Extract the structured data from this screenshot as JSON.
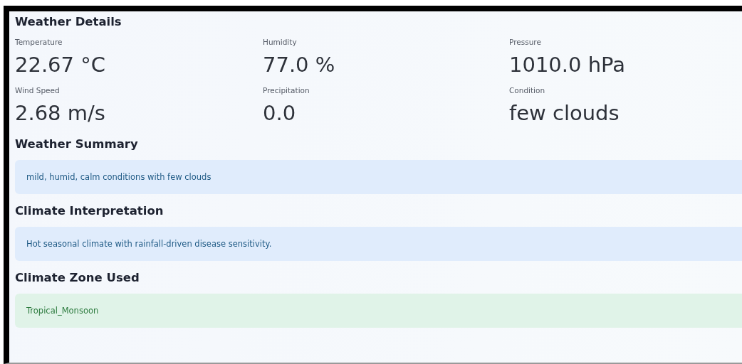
{
  "title": "Weather Details",
  "metrics": [
    {
      "label": "Temperature",
      "value": "22.67 °C"
    },
    {
      "label": "Humidity",
      "value": "77.0 %"
    },
    {
      "label": "Pressure",
      "value": "1010.0 hPa"
    },
    {
      "label": "Wind Speed",
      "value": "2.68 m/s"
    },
    {
      "label": "Precipitation",
      "value": "0.0"
    },
    {
      "label": "Condition",
      "value": "few clouds"
    }
  ],
  "sections": [
    {
      "heading": "Weather Summary",
      "kind": "info",
      "text": "mild, humid, calm conditions with few clouds"
    },
    {
      "heading": "Climate Interpretation",
      "kind": "info",
      "text": "Hot seasonal climate with rainfall-driven disease sensitivity."
    },
    {
      "heading": "Climate Zone Used",
      "kind": "success",
      "text": "Tropical_Monsoon"
    }
  ]
}
